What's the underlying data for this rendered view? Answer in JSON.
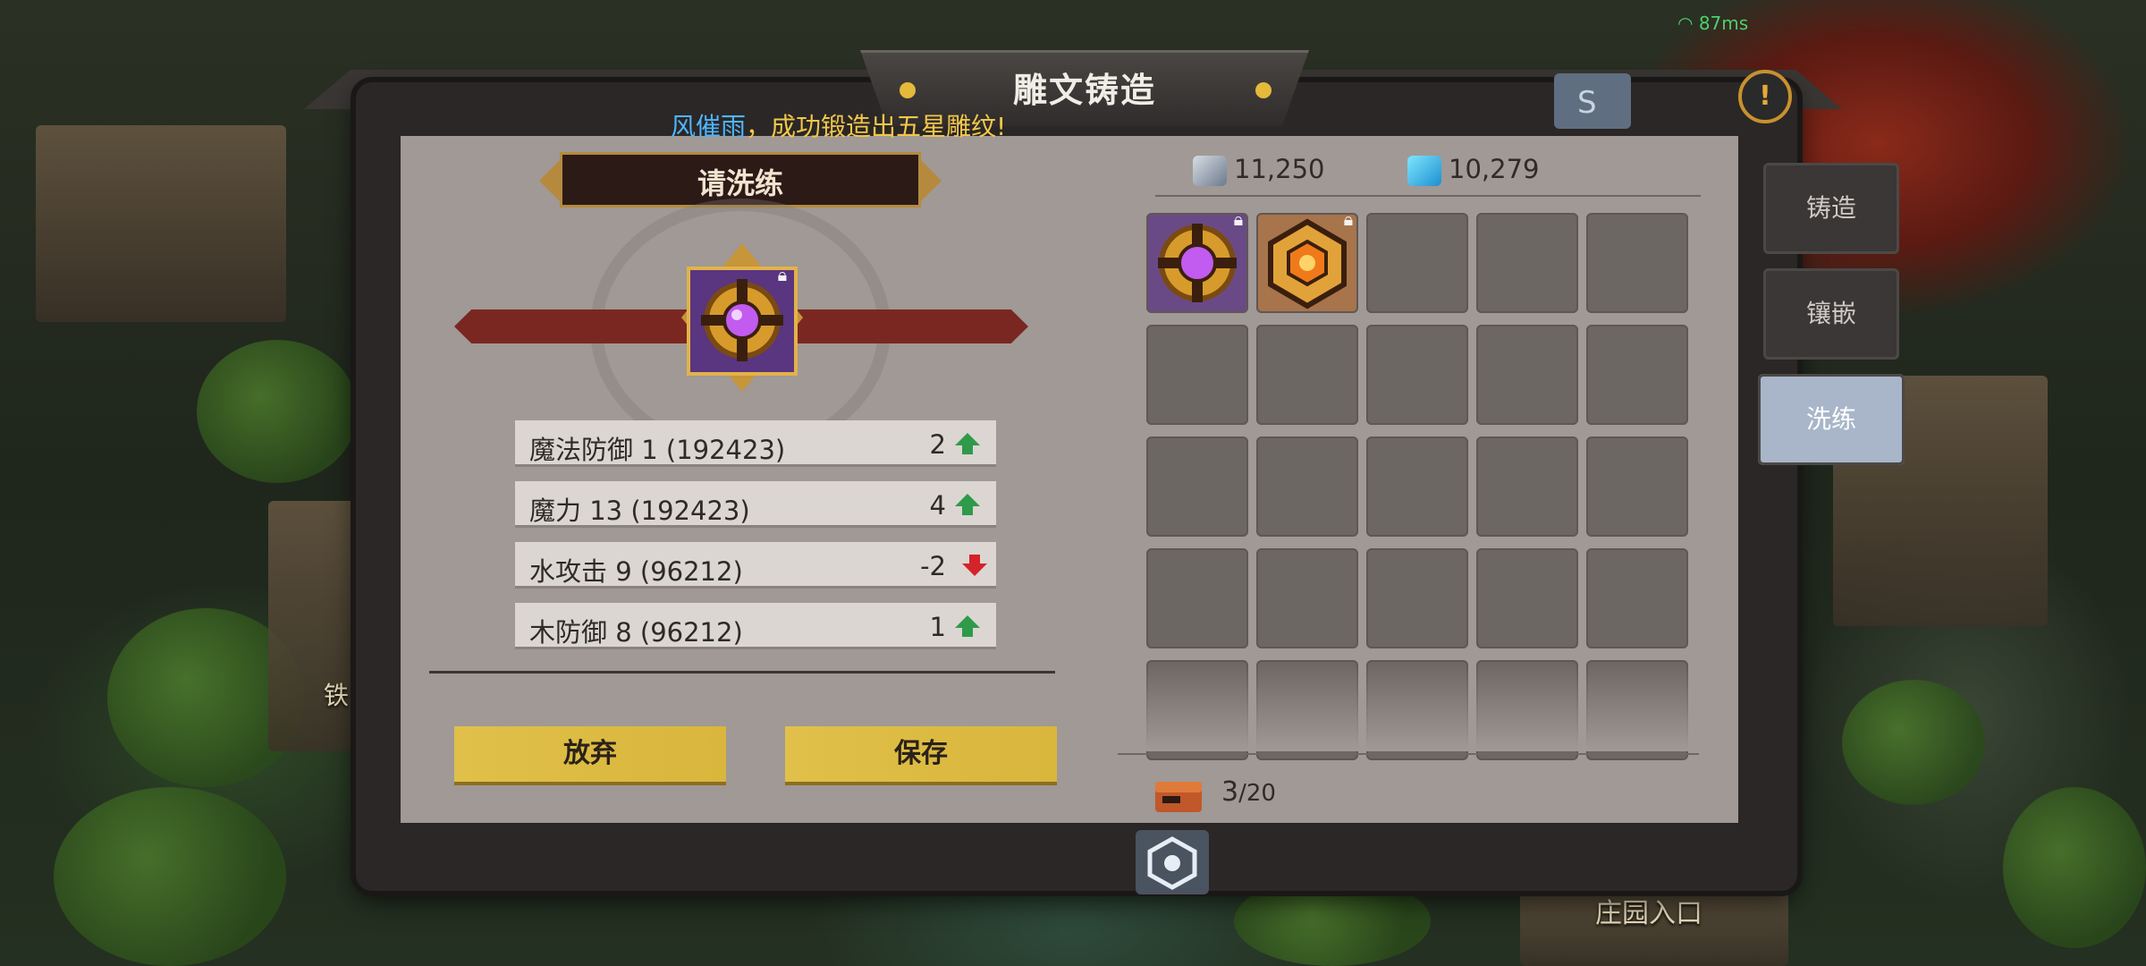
{
  "status": {
    "ping": "87ms"
  },
  "window": {
    "title": "雕文铸造"
  },
  "broadcast": {
    "name": "风催雨",
    "message": "，成功锻造出五星雕纹!"
  },
  "refine_panel": {
    "header": "请洗练",
    "stats": [
      {
        "label": "魔法防御 1 (192423)",
        "delta": "2",
        "trend": "up"
      },
      {
        "label": "魔力 13 (192423)",
        "delta": "4",
        "trend": "up"
      },
      {
        "label": "水攻击 9 (96212)",
        "delta": "-2",
        "trend": "down"
      },
      {
        "label": "木防御 8 (96212)",
        "delta": "1",
        "trend": "up"
      }
    ],
    "abandon_label": "放弃",
    "save_label": "保存"
  },
  "currency": {
    "silver": "11,250",
    "crystal": "10,279"
  },
  "inventory": {
    "count": "3",
    "capacity": "/20",
    "items": [
      {
        "icon": "purple-glyph-icon",
        "locked": true
      },
      {
        "icon": "orange-glyph-icon",
        "locked": true
      }
    ]
  },
  "tabs": [
    {
      "label": "铸造",
      "active": false
    },
    {
      "label": "镶嵌",
      "active": false
    },
    {
      "label": "洗练",
      "active": true
    }
  ],
  "scene": {
    "manor_entrance": "庄园入口",
    "iron_label": "铁"
  },
  "colors": {
    "accent_gold": "#e0c04a",
    "up": "#2e9a4a",
    "down": "#d4232a",
    "active_tab": "#a9b6c9"
  }
}
